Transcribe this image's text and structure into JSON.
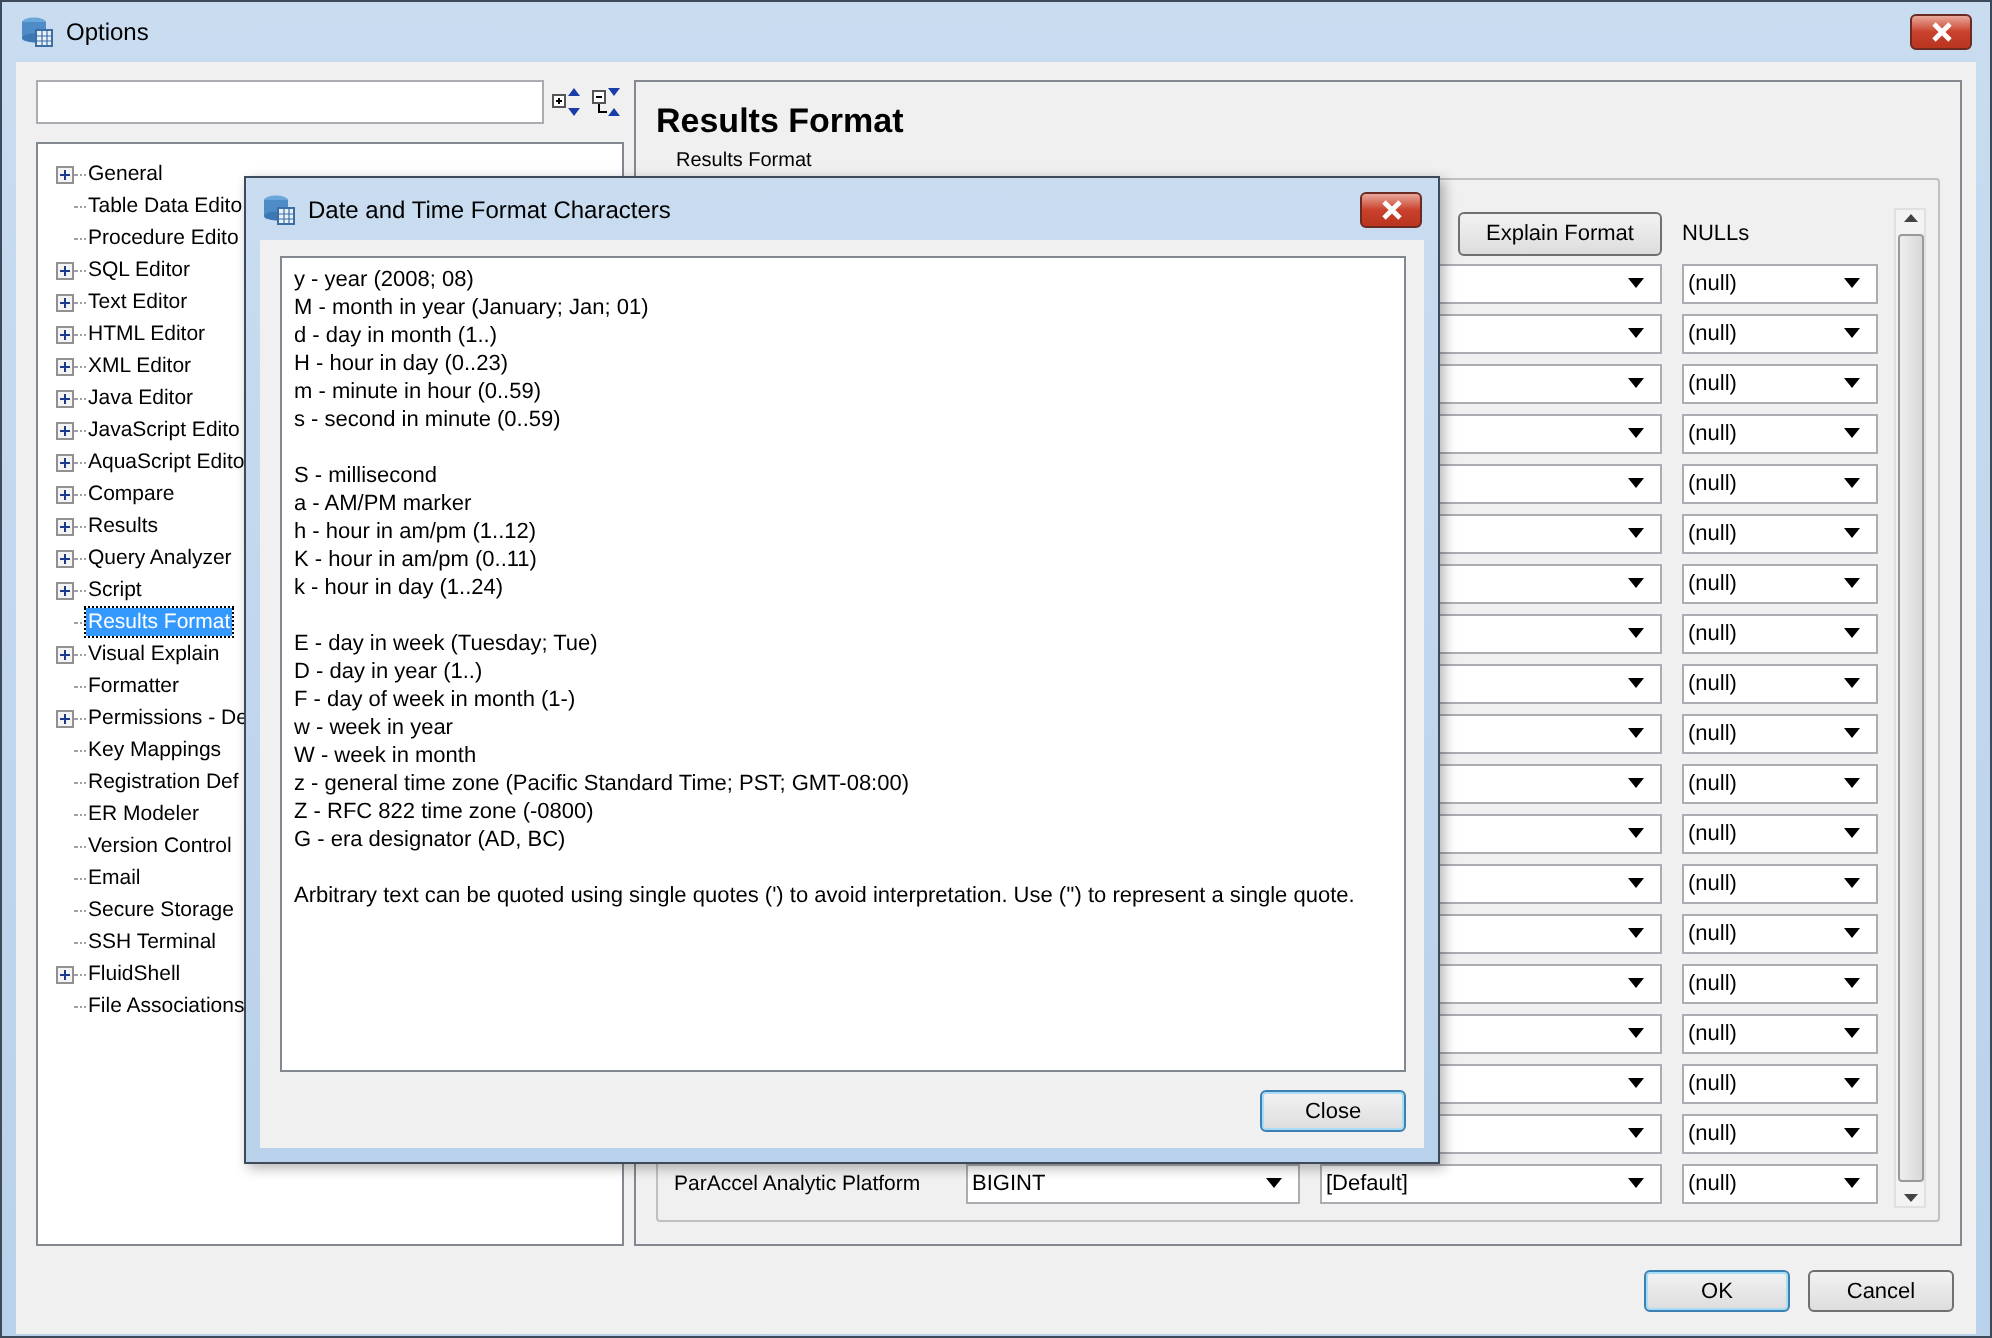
{
  "window": {
    "title": "Options"
  },
  "tree": [
    {
      "label": "General",
      "expandable": true,
      "selected": false
    },
    {
      "label": "Table Data Edito",
      "expandable": false,
      "selected": false
    },
    {
      "label": "Procedure Edito",
      "expandable": false,
      "selected": false
    },
    {
      "label": "SQL Editor",
      "expandable": true,
      "selected": false
    },
    {
      "label": "Text Editor",
      "expandable": true,
      "selected": false
    },
    {
      "label": "HTML Editor",
      "expandable": true,
      "selected": false
    },
    {
      "label": "XML Editor",
      "expandable": true,
      "selected": false
    },
    {
      "label": "Java Editor",
      "expandable": true,
      "selected": false
    },
    {
      "label": "JavaScript Edito",
      "expandable": true,
      "selected": false
    },
    {
      "label": "AquaScript Edito",
      "expandable": true,
      "selected": false
    },
    {
      "label": "Compare",
      "expandable": true,
      "selected": false
    },
    {
      "label": "Results",
      "expandable": true,
      "selected": false
    },
    {
      "label": "Query Analyzer",
      "expandable": true,
      "selected": false
    },
    {
      "label": "Script",
      "expandable": true,
      "selected": false
    },
    {
      "label": "Results Format",
      "expandable": false,
      "selected": true
    },
    {
      "label": "Visual Explain",
      "expandable": true,
      "selected": false
    },
    {
      "label": "Formatter",
      "expandable": false,
      "selected": false
    },
    {
      "label": "Permissions - De",
      "expandable": true,
      "selected": false
    },
    {
      "label": "Key Mappings",
      "expandable": false,
      "selected": false
    },
    {
      "label": "Registration Def",
      "expandable": false,
      "selected": false
    },
    {
      "label": "ER Modeler",
      "expandable": false,
      "selected": false
    },
    {
      "label": "Version Control",
      "expandable": false,
      "selected": false
    },
    {
      "label": "Email",
      "expandable": false,
      "selected": false
    },
    {
      "label": "Secure Storage",
      "expandable": false,
      "selected": false
    },
    {
      "label": "SSH Terminal",
      "expandable": false,
      "selected": false
    },
    {
      "label": "FluidShell",
      "expandable": true,
      "selected": false
    },
    {
      "label": "File Associations",
      "expandable": false,
      "selected": false
    }
  ],
  "panel": {
    "title": "Results Format",
    "group_label": "Results Format",
    "explain_button": "Explain Format",
    "nulls_header": "NULLs",
    "rows": [
      {
        "nulls": "(null)"
      },
      {
        "nulls": "(null)"
      },
      {
        "nulls": "(null)"
      },
      {
        "nulls": "(null)"
      },
      {
        "nulls": "(null)"
      },
      {
        "nulls": "(null)"
      },
      {
        "nulls": "(null)"
      },
      {
        "nulls": "(null)"
      },
      {
        "nulls": "(null)"
      },
      {
        "nulls": "(null)"
      },
      {
        "nulls": "(null)"
      },
      {
        "nulls": "(null)"
      },
      {
        "nulls": "(null)"
      },
      {
        "nulls": "(null)"
      },
      {
        "nulls": "(null)"
      },
      {
        "nulls": "(null)"
      },
      {
        "nulls": "(null)"
      },
      {
        "nulls": "(null)"
      },
      {
        "label": "ParAccel Analytic Platform",
        "type": "BIGINT",
        "format": "[Default]",
        "nulls": "(null)"
      }
    ]
  },
  "dialog": {
    "title": "Date and Time Format Characters",
    "paragraphs": [
      [
        "y - year (2008; 08)",
        "M - month in year (January; Jan; 01)",
        "d - day in month (1..)",
        "H - hour in day (0..23)",
        "m - minute in hour (0..59)",
        "s - second in minute (0..59)"
      ],
      [
        "S - millisecond",
        "a - AM/PM marker",
        "h - hour in am/pm (1..12)",
        "K - hour in am/pm (0..11)",
        "k - hour in day (1..24)"
      ],
      [
        "E - day in week (Tuesday; Tue)",
        "D - day in year (1..)",
        "F - day of week in month (1-)",
        "w - week in year",
        "W - week in month",
        "z - general time zone (Pacific Standard Time; PST; GMT-08:00)",
        "Z - RFC 822 time zone (-0800)",
        "G - era designator (AD, BC)"
      ],
      [
        "Arbitrary text can be quoted using single quotes (') to avoid interpretation.  Use ('') to represent a single quote."
      ]
    ],
    "close_button": "Close"
  },
  "buttons": [
    {
      "label": "OK",
      "default": true
    },
    {
      "label": "Cancel",
      "default": false
    }
  ]
}
